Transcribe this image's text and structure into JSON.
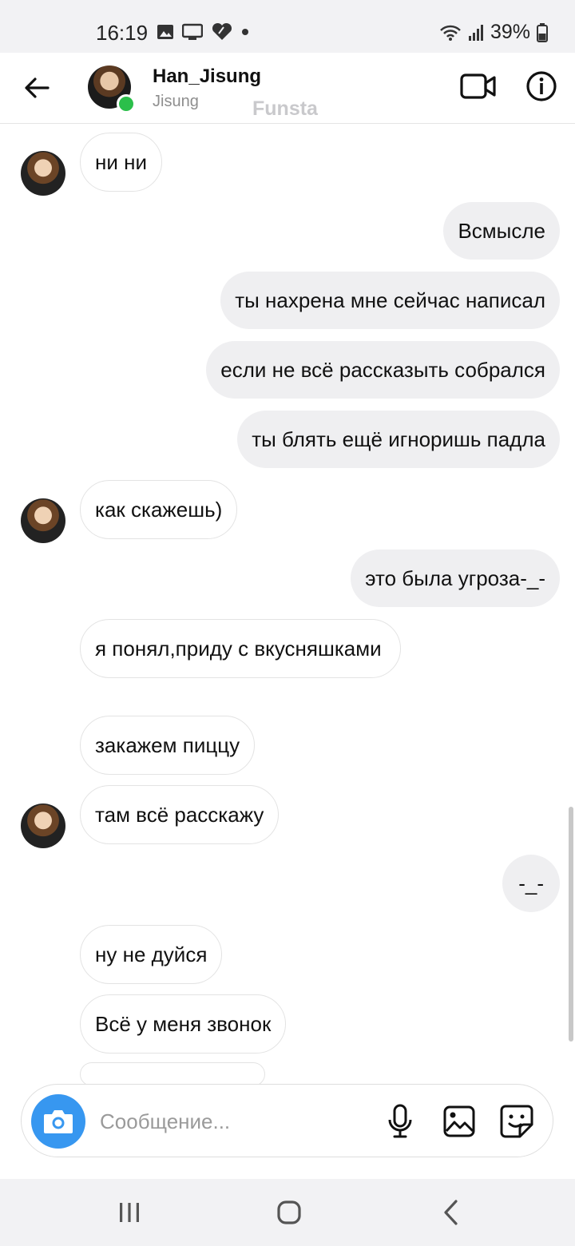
{
  "status_bar": {
    "time": "16:19",
    "battery": "39%"
  },
  "header": {
    "name": "Han_Jisung",
    "subtitle": "Jisung",
    "watermark": "Funsta"
  },
  "messages": [
    {
      "side": "in",
      "text": "ни ни"
    },
    {
      "side": "out",
      "text": "Всмысле"
    },
    {
      "side": "out",
      "text": "ты нахрена мне сейчас написал"
    },
    {
      "side": "out",
      "text": "если не всё рассказыть собрался"
    },
    {
      "side": "out",
      "text": "ты блять ещё игноришь падла"
    },
    {
      "side": "in",
      "text": "как скажешь)"
    },
    {
      "side": "out",
      "text": "это была угроза-_-"
    },
    {
      "side": "in",
      "text": "я понял,приду с вкусняшками"
    },
    {
      "side": "in",
      "text": "закажем пиццу"
    },
    {
      "side": "in",
      "text": "там всё расскажу"
    },
    {
      "side": "out",
      "text": "-_-"
    },
    {
      "side": "in",
      "text": "ну не дуйся"
    },
    {
      "side": "in",
      "text": "Всё у меня звонок"
    }
  ],
  "composer": {
    "placeholder": "Сообщение..."
  },
  "colors": {
    "accent": "#3797f0",
    "online": "#2bbf4a",
    "outgoing_bubble": "#efeff1",
    "incoming_border": "#e3e3e3"
  },
  "icons": [
    "back-arrow-icon",
    "video-call-icon",
    "info-icon",
    "camera-icon",
    "microphone-icon",
    "gallery-icon",
    "sticker-icon"
  ]
}
